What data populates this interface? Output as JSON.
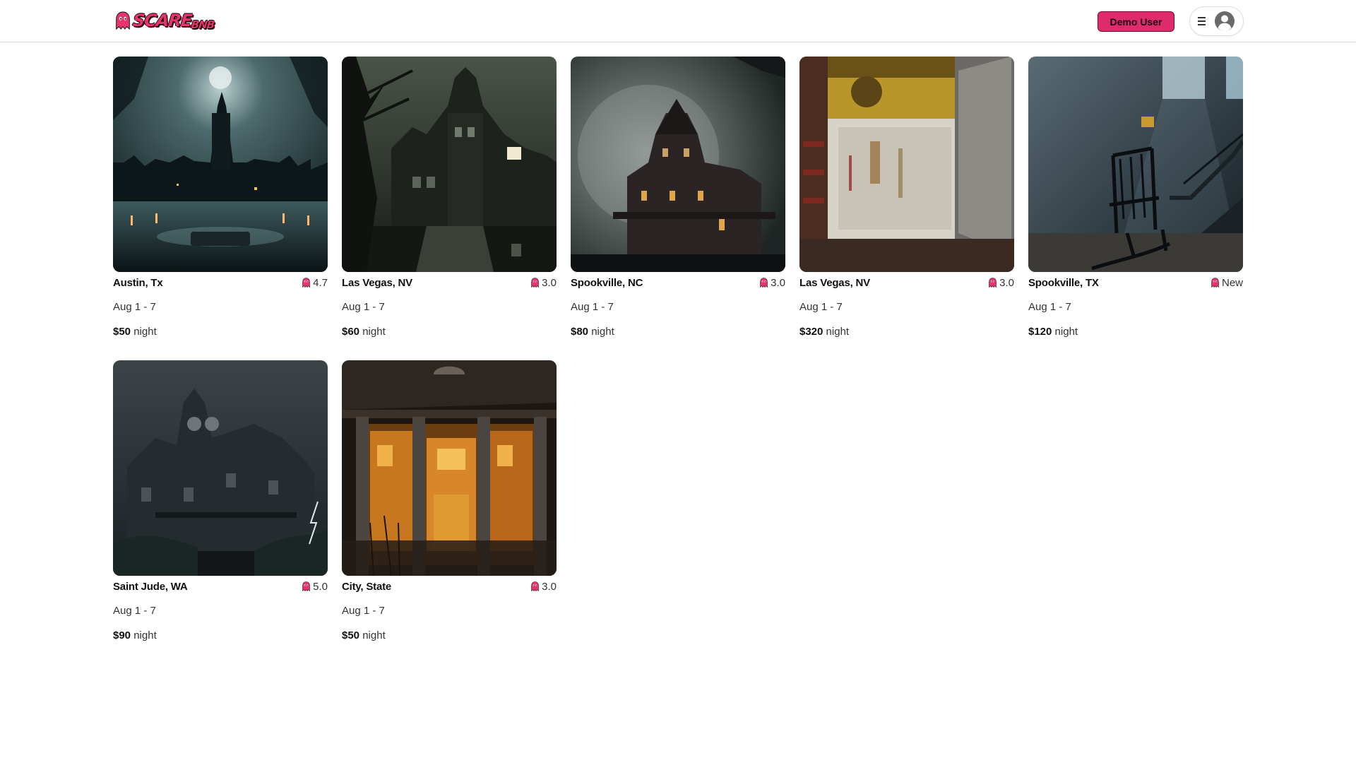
{
  "header": {
    "logo_text_main": "SCARE",
    "logo_text_small": "BNB",
    "demo_user_label": "Demo User"
  },
  "colors": {
    "brand": "#df2a6b",
    "ghost": "#e8336d"
  },
  "icons": {
    "logo": "ghost-icon",
    "menu": "hamburger-menu-icon",
    "profile": "user-circle-icon",
    "rating": "ghost-icon"
  },
  "listings": [
    {
      "city": "Austin, Tx",
      "rating": "4.7",
      "dates": "Aug 1 - 7",
      "price": "$50",
      "unit": "night",
      "image": "dark castle by a lake under a full moon"
    },
    {
      "city": "Las Vegas, NV",
      "rating": "3.0",
      "dates": "Aug 1 - 7",
      "price": "$60",
      "unit": "night",
      "image": "gothic haunted mansion with dead trees"
    },
    {
      "city": "Spookville, NC",
      "rating": "3.0",
      "dates": "Aug 1 - 7",
      "price": "$80",
      "unit": "night",
      "image": "haunted victorian house in front of a large moon"
    },
    {
      "city": "Las Vegas, NV",
      "rating": "3.0",
      "dates": "Aug 1 - 7",
      "price": "$320",
      "unit": "night",
      "image": "bloody white door in an abandoned room"
    },
    {
      "city": "Spookville, TX",
      "rating": "New",
      "dates": "Aug 1 - 7",
      "price": "$120",
      "unit": "night",
      "image": "rocking chair in a dim room with stairs"
    },
    {
      "city": "Saint Jude, WA",
      "rating": "5.0",
      "dates": "Aug 1 - 7",
      "price": "$90",
      "unit": "night",
      "image": "victorian mansion under stormy sky"
    },
    {
      "city": "City, State",
      "rating": "3.0",
      "dates": "Aug 1 - 7",
      "price": "$50",
      "unit": "night",
      "image": "old columned mansion with glowing orange windows"
    }
  ]
}
